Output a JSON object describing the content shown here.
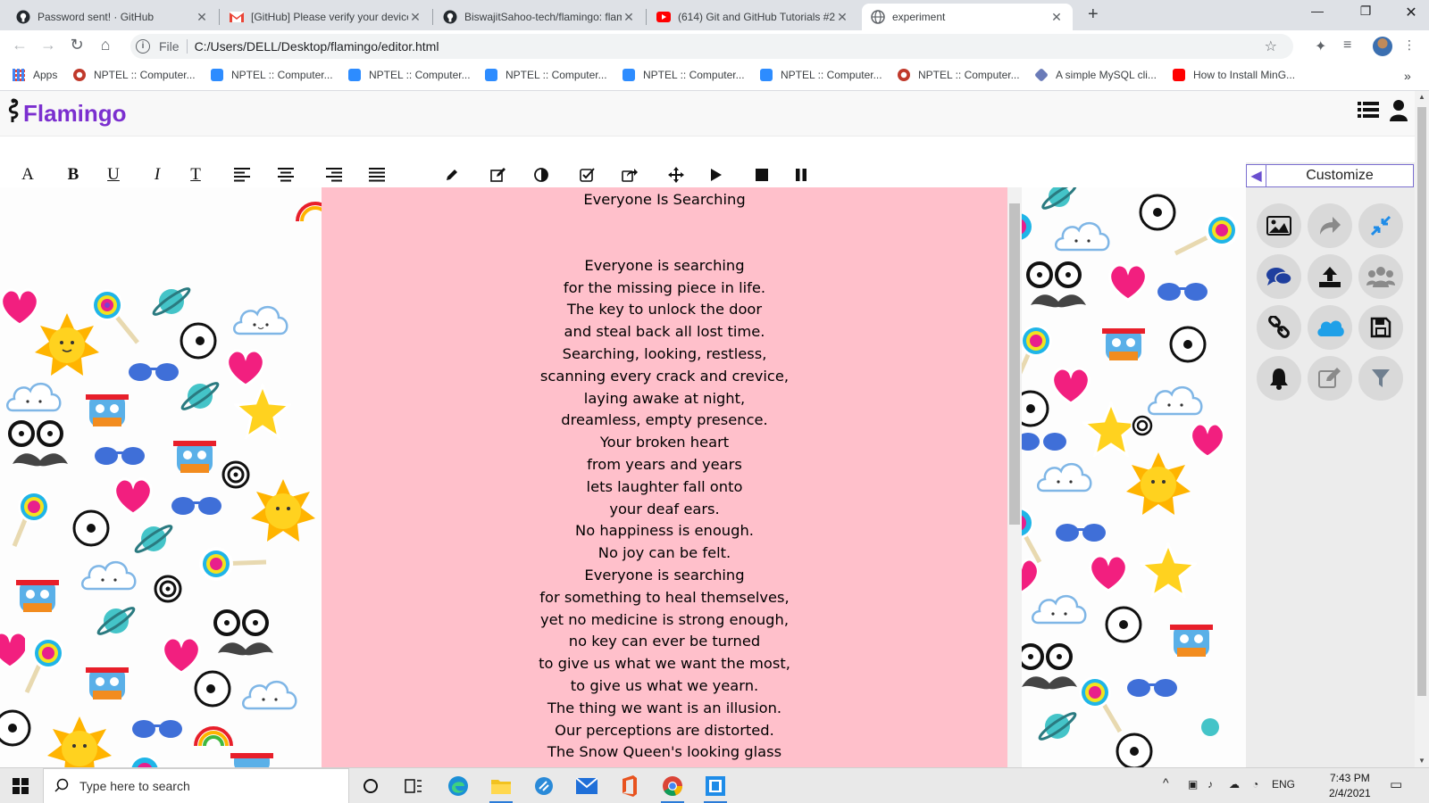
{
  "browser": {
    "tabs": [
      {
        "title": "Password sent! · GitHub",
        "favicon": "github-icon",
        "active": false
      },
      {
        "title": "[GitHub] Please verify your device",
        "favicon": "gmail-icon",
        "active": false
      },
      {
        "title": "BiswajitSahoo-tech/flamingo: flamingo",
        "favicon": "github-icon",
        "active": false
      },
      {
        "title": "(614) Git and GitHub Tutorials #2",
        "favicon": "youtube-icon",
        "active": false
      },
      {
        "title": "experiment",
        "favicon": "globe-icon",
        "active": true
      }
    ],
    "address": {
      "scheme_label": "File",
      "url": "C:/Users/DELL/Desktop/flamingo/editor.html"
    },
    "bookmarks": [
      {
        "label": "Apps",
        "icon": "apps-grid-icon"
      },
      {
        "label": "NPTEL :: Computer...",
        "icon": "nptel-icon"
      },
      {
        "label": "NPTEL :: Computer...",
        "icon": "zoom-icon"
      },
      {
        "label": "NPTEL :: Computer...",
        "icon": "zoom-icon"
      },
      {
        "label": "NPTEL :: Computer...",
        "icon": "zoom-icon"
      },
      {
        "label": "NPTEL :: Computer...",
        "icon": "zoom-icon"
      },
      {
        "label": "NPTEL :: Computer...",
        "icon": "zoom-icon"
      },
      {
        "label": "NPTEL :: Computer...",
        "icon": "nptel-icon"
      },
      {
        "label": "A simple MySQL cli...",
        "icon": "cube-icon"
      },
      {
        "label": "How to Install MinG...",
        "icon": "youtube-icon"
      }
    ]
  },
  "app": {
    "name": "Flamingo",
    "brand_color": "#7b2fcf",
    "editor_bg": "#ffc0cb",
    "formatting": [
      {
        "glyph": "A",
        "icon": "font-icon"
      },
      {
        "glyph": "B",
        "icon": "bold-icon"
      },
      {
        "glyph": "U",
        "icon": "underline-icon"
      },
      {
        "glyph": "I",
        "icon": "italic-icon"
      },
      {
        "glyph": "T",
        "icon": "strikethrough-text-icon"
      },
      {
        "glyph": "",
        "icon": "align-left-icon"
      },
      {
        "glyph": "",
        "icon": "align-center-icon"
      },
      {
        "glyph": "",
        "icon": "align-right-icon"
      },
      {
        "glyph": "",
        "icon": "align-justify-icon"
      },
      {
        "glyph": "",
        "icon": "pencil-icon"
      },
      {
        "glyph": "",
        "icon": "edit-icon"
      },
      {
        "glyph": "",
        "icon": "contrast-icon"
      },
      {
        "glyph": "",
        "icon": "checkbox-icon"
      },
      {
        "glyph": "",
        "icon": "share-icon"
      },
      {
        "glyph": "",
        "icon": "move-icon"
      },
      {
        "glyph": "",
        "icon": "play-icon"
      },
      {
        "glyph": "",
        "icon": "stop-icon"
      },
      {
        "glyph": "",
        "icon": "pause-icon"
      }
    ],
    "customize_label": "Customize",
    "customize_buttons": [
      "image-icon",
      "share-arrow-icon",
      "compress-icon",
      "comments-icon",
      "upload-icon",
      "users-icon",
      "link-icon",
      "cloud-icon",
      "save-icon",
      "bell-icon",
      "edit-square-icon",
      "filter-icon"
    ],
    "poem": {
      "title": "Everyone Is Searching",
      "lines": [
        "Everyone is searching",
        "for the missing piece in life.",
        "The key to unlock the door",
        "and steal back all lost time.",
        "Searching, looking, restless,",
        "scanning every crack and crevice,",
        "laying awake at night,",
        "dreamless, empty presence.",
        "Your broken heart",
        "from years and years",
        "lets laughter fall onto",
        "your deaf ears.",
        "No happiness is enough.",
        "No joy can be felt.",
        "Everyone is searching",
        "for something to heal themselves,",
        "yet no medicine is strong enough,",
        "no key can ever be turned",
        "to give us what we want the most,",
        "to give us what we yearn.",
        "The thing we want is an illusion.",
        "Our perceptions are distorted.",
        "The Snow Queen's looking glass"
      ]
    }
  },
  "taskbar": {
    "search_placeholder": "Type here to search",
    "apps": [
      "cortana-icon",
      "task-view-icon",
      "edge-icon",
      "file-explorer-icon",
      "app-icon",
      "mail-icon",
      "office-icon",
      "chrome-icon",
      "terminal-icon"
    ],
    "language": "ENG",
    "time": "7:43 PM",
    "date": "2/4/2021"
  }
}
